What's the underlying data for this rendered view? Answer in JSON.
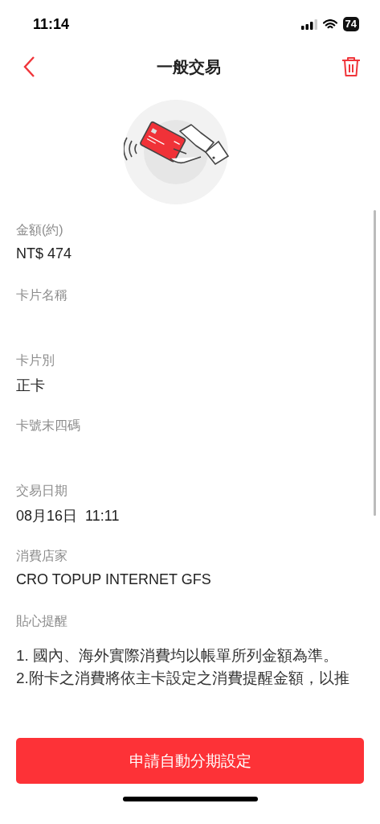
{
  "status_bar": {
    "time": "11:14",
    "battery": "74"
  },
  "nav": {
    "title": "一般交易"
  },
  "fields": [
    {
      "label": "金額(約)",
      "value": "NT$ 474"
    },
    {
      "label": "卡片名稱"
    },
    {
      "label": "卡片別",
      "value": "正卡"
    },
    {
      "label": "卡號末四碼"
    },
    {
      "label": "交易日期",
      "value": "08月16日  11:11"
    },
    {
      "label": "消費店家",
      "value": "CRO TOPUP INTERNET GFS"
    }
  ],
  "reminder": {
    "label": "貼心提醒",
    "lines": [
      "1. 國內、海外實際消費均以帳單所列金額為準。",
      "2.附卡之消費將依主卡設定之消費提醒金額，以推"
    ]
  },
  "action_button": "申請自動分期設定"
}
